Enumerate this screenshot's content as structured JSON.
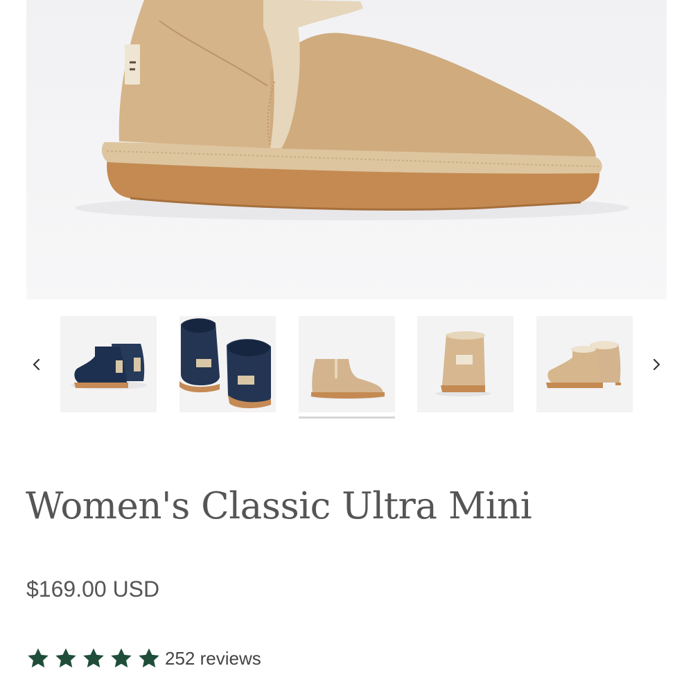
{
  "product": {
    "title": "Women's Classic Ultra Mini",
    "price": "$169.00 USD",
    "rating": {
      "stars": 5,
      "reviews_count": 252,
      "reviews_label": "252 reviews",
      "star_color": "#1f4d3a"
    }
  },
  "gallery": {
    "main_image": "chestnut-ultra-mini-boot-side-closeup",
    "thumbnails": [
      {
        "name": "navy-boots-pair-side",
        "color": "#233552"
      },
      {
        "name": "navy-boots-pair-back",
        "color": "#233552"
      },
      {
        "name": "chestnut-boot-side",
        "color": "#d3b48e",
        "selected": true
      },
      {
        "name": "chestnut-boot-back",
        "color": "#d3b48e"
      },
      {
        "name": "chestnut-boots-pair-angle",
        "color": "#d3b48e"
      }
    ],
    "prev_icon": "chevron-left-icon",
    "next_icon": "chevron-right-icon"
  }
}
